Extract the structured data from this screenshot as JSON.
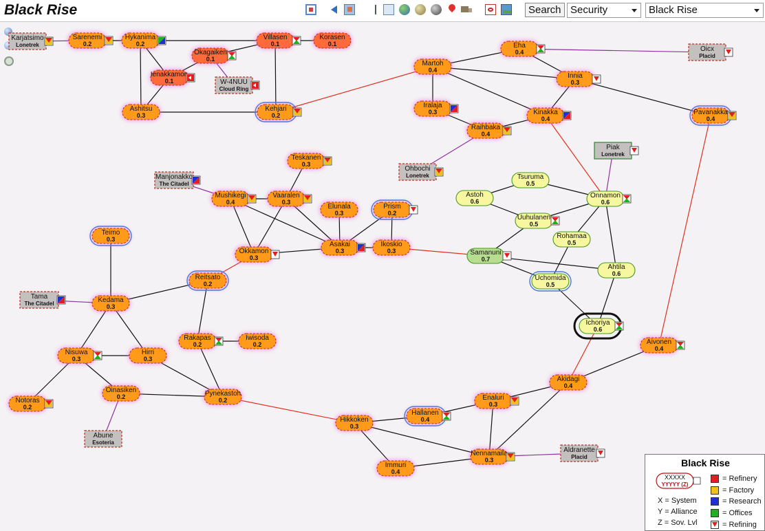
{
  "header": {
    "title": "Black Rise",
    "search_label": "Search",
    "view_mode": "Security",
    "region": "Black Rise",
    "toolbar_icons": [
      "map-icon",
      "back-icon",
      "gallery-icon",
      "table-icon",
      "globe-icon",
      "moon-icon",
      "planet-icon",
      "location-pin-icon",
      "truck-icon",
      "pdf-icon",
      "picture-icon"
    ]
  },
  "legend": {
    "title": "Black Rise",
    "sample_name": "XXXXX",
    "sample_sub": "YYYYY (Z)",
    "keys": [
      "X  = System",
      "Y  = Alliance",
      "Z  = Sov. Lvl"
    ],
    "items": [
      {
        "label": "= Refinery",
        "color": "#e02020"
      },
      {
        "label": "= Factory",
        "color": "#f0c020"
      },
      {
        "label": "= Research",
        "color": "#2030d0"
      },
      {
        "label": "= Offices",
        "color": "#20b020"
      },
      {
        "label": "= Refining",
        "color": "#e02020"
      }
    ]
  },
  "colors": {
    "low": "#ff9a1a",
    "low_dark": "#ff6a3a",
    "mid": "#f7f7a0",
    "mid_green": "#b8dc90",
    "ext": "#c4c0c0",
    "conn": "#111",
    "region_conn": "#e03020",
    "const_conn": "#9030a0"
  },
  "systems": [
    {
      "id": "karjatsimo",
      "name": "Karjatsimo",
      "sub": "Lonetrek",
      "type": "ext"
    },
    {
      "id": "sarenemi",
      "name": "Sarenemi",
      "sub": "0.2",
      "type": "low"
    },
    {
      "id": "hykanima",
      "name": "Hykanima",
      "sub": "0.2",
      "type": "low"
    },
    {
      "id": "villasen",
      "name": "Villasen",
      "sub": "0.1",
      "type": "low2"
    },
    {
      "id": "korasen",
      "name": "Korasen",
      "sub": "0.1",
      "type": "low2"
    },
    {
      "id": "okagaiken",
      "name": "Okagaiken",
      "sub": "0.1",
      "type": "low2"
    },
    {
      "id": "ienakkamon",
      "name": "Ienakkamon",
      "sub": "0.1",
      "type": "low2"
    },
    {
      "id": "w4nuu",
      "name": "W-4NUU",
      "sub": "Cloud Ring",
      "type": "ext"
    },
    {
      "id": "ashitsu",
      "name": "Ashitsu",
      "sub": "0.3",
      "type": "low"
    },
    {
      "id": "kehjari",
      "name": "Kehjari",
      "sub": "0.2",
      "type": "low",
      "ring": true
    },
    {
      "id": "eha",
      "name": "Eha",
      "sub": "0.4",
      "type": "low"
    },
    {
      "id": "oicx",
      "name": "Oicx",
      "sub": "Placid",
      "type": "ext"
    },
    {
      "id": "martoh",
      "name": "Martoh",
      "sub": "0.4",
      "type": "low"
    },
    {
      "id": "innia",
      "name": "Innia",
      "sub": "0.3",
      "type": "low"
    },
    {
      "id": "iralaja",
      "name": "Iralaja",
      "sub": "0.3",
      "type": "low"
    },
    {
      "id": "kinakka",
      "name": "Kinakka",
      "sub": "0.4",
      "type": "low"
    },
    {
      "id": "raihbaka",
      "name": "Raihbaka",
      "sub": "0.4",
      "type": "low"
    },
    {
      "id": "pavanakka",
      "name": "Pavanakka",
      "sub": "0.4",
      "type": "low",
      "ring": true
    },
    {
      "id": "piak",
      "name": "Piak",
      "sub": "Lonetrek",
      "type": "ext_green"
    },
    {
      "id": "ohbochi",
      "name": "Ohbochi",
      "sub": "Lonetrek",
      "type": "ext"
    },
    {
      "id": "teskanen",
      "name": "Teskanen",
      "sub": "0.3",
      "type": "low"
    },
    {
      "id": "manjonakko",
      "name": "Manjonakko",
      "sub": "The Citadel",
      "type": "ext"
    },
    {
      "id": "mushikegi",
      "name": "Mushikegi",
      "sub": "0.4",
      "type": "low"
    },
    {
      "id": "vaaralen",
      "name": "Vaaralen",
      "sub": "0.3",
      "type": "low"
    },
    {
      "id": "elunala",
      "name": "Elunala",
      "sub": "0.3",
      "type": "low"
    },
    {
      "id": "prism",
      "name": "Prism",
      "sub": "0.2",
      "type": "low",
      "ring": true
    },
    {
      "id": "tsuruma",
      "name": "Tsuruma",
      "sub": "0.5",
      "type": "mid"
    },
    {
      "id": "astoh",
      "name": "Astoh",
      "sub": "0.6",
      "type": "mid"
    },
    {
      "id": "onnamon",
      "name": "Onnamon",
      "sub": "0.6",
      "type": "mid"
    },
    {
      "id": "uuhulanen",
      "name": "Uuhulanen",
      "sub": "0.5",
      "type": "mid"
    },
    {
      "id": "rohamaa",
      "name": "Rohamaa",
      "sub": "0.5",
      "type": "mid"
    },
    {
      "id": "teimo",
      "name": "Teimo",
      "sub": "0.3",
      "type": "low",
      "ring": true
    },
    {
      "id": "okkamon",
      "name": "Okkamon",
      "sub": "0.3",
      "type": "low"
    },
    {
      "id": "asakai",
      "name": "Asakai",
      "sub": "0.3",
      "type": "low"
    },
    {
      "id": "ikoskio",
      "name": "Ikoskio",
      "sub": "0.3",
      "type": "low"
    },
    {
      "id": "samanuni",
      "name": "Samanuni",
      "sub": "0.7",
      "type": "mid_green"
    },
    {
      "id": "ahtila",
      "name": "Ahtila",
      "sub": "0.6",
      "type": "mid"
    },
    {
      "id": "uchomida",
      "name": "Uchomida",
      "sub": "0.5",
      "type": "mid",
      "ring": true
    },
    {
      "id": "reitsato",
      "name": "Reitsato",
      "sub": "0.2",
      "type": "low",
      "ring": true
    },
    {
      "id": "tama",
      "name": "Tama",
      "sub": "The Citadel",
      "type": "ext"
    },
    {
      "id": "kedama",
      "name": "Kedama",
      "sub": "0.3",
      "type": "low"
    },
    {
      "id": "ichoriya",
      "name": "Ichoriya",
      "sub": "0.6",
      "type": "mid",
      "current": true
    },
    {
      "id": "rakapas",
      "name": "Rakapas",
      "sub": "0.2",
      "type": "low"
    },
    {
      "id": "iwisoda",
      "name": "Iwisoda",
      "sub": "0.2",
      "type": "low"
    },
    {
      "id": "aivonen",
      "name": "Aivonen",
      "sub": "0.4",
      "type": "low"
    },
    {
      "id": "nisuwa",
      "name": "Nisuwa",
      "sub": "0.3",
      "type": "low"
    },
    {
      "id": "hirri",
      "name": "Hirri",
      "sub": "0.3",
      "type": "low"
    },
    {
      "id": "akidagi",
      "name": "Akidagi",
      "sub": "0.4",
      "type": "low"
    },
    {
      "id": "oinasiken",
      "name": "Oinasiken",
      "sub": "0.2",
      "type": "low"
    },
    {
      "id": "pynekastoh",
      "name": "Pynekastoh",
      "sub": "0.2",
      "type": "low"
    },
    {
      "id": "enaluri",
      "name": "Enaluri",
      "sub": "0.3",
      "type": "low"
    },
    {
      "id": "notoras",
      "name": "Notoras",
      "sub": "0.2",
      "type": "low"
    },
    {
      "id": "hallanen",
      "name": "Hallanen",
      "sub": "0.4",
      "type": "low",
      "ring": true
    },
    {
      "id": "hikkoken",
      "name": "Hikkoken",
      "sub": "0.3",
      "type": "low"
    },
    {
      "id": "abune",
      "name": "Abune",
      "sub": "Esoteria",
      "type": "ext"
    },
    {
      "id": "nennamaila",
      "name": "Nennamaila",
      "sub": "0.3",
      "type": "low"
    },
    {
      "id": "aldranette",
      "name": "Aldranette",
      "sub": "Placid",
      "type": "ext"
    },
    {
      "id": "immuri",
      "name": "Immuri",
      "sub": "0.4",
      "type": "low"
    }
  ],
  "connections": [
    [
      "karjatsimo",
      "sarenemi",
      "c"
    ],
    [
      "sarenemi",
      "hykanima",
      "n"
    ],
    [
      "hykanima",
      "villasen",
      "n"
    ],
    [
      "villasen",
      "korasen",
      "n"
    ],
    [
      "villasen",
      "okagaiken",
      "n"
    ],
    [
      "villasen",
      "kehjari",
      "n"
    ],
    [
      "okagaiken",
      "ienakkamon",
      "n"
    ],
    [
      "okagaiken",
      "w4nuu",
      "c"
    ],
    [
      "hykanima",
      "ienakkamon",
      "n"
    ],
    [
      "hykanima",
      "ashitsu",
      "n"
    ],
    [
      "ienakkamon",
      "ashitsu",
      "n"
    ],
    [
      "ashitsu",
      "kehjari",
      "n"
    ],
    [
      "kehjari",
      "martoh",
      "r"
    ],
    [
      "martoh",
      "eha",
      "n"
    ],
    [
      "martoh",
      "innia",
      "n"
    ],
    [
      "martoh",
      "iralaja",
      "n"
    ],
    [
      "martoh",
      "kinakka",
      "n"
    ],
    [
      "eha",
      "innia",
      "n"
    ],
    [
      "eha",
      "oicx",
      "c"
    ],
    [
      "innia",
      "kinakka",
      "n"
    ],
    [
      "innia",
      "pavanakka",
      "n"
    ],
    [
      "iralaja",
      "raihbaka",
      "n"
    ],
    [
      "kinakka",
      "raihbaka",
      "n"
    ],
    [
      "raihbaka",
      "ohbochi",
      "c"
    ],
    [
      "kinakka",
      "onnamon",
      "r"
    ],
    [
      "onnamon",
      "piak",
      "c"
    ],
    [
      "pavanakka",
      "aivonen",
      "r"
    ],
    [
      "teskanen",
      "vaaralen",
      "n"
    ],
    [
      "manjonakko",
      "mushikegi",
      "c"
    ],
    [
      "mushikegi",
      "vaaralen",
      "n"
    ],
    [
      "mushikegi",
      "okkamon",
      "n"
    ],
    [
      "mushikegi",
      "asakai",
      "n"
    ],
    [
      "vaaralen",
      "asakai",
      "n"
    ],
    [
      "vaaralen",
      "okkamon",
      "n"
    ],
    [
      "elunala",
      "asakai",
      "n"
    ],
    [
      "prism",
      "asakai",
      "n"
    ],
    [
      "prism",
      "ikoskio",
      "n"
    ],
    [
      "asakai",
      "ikoskio",
      "n"
    ],
    [
      "asakai",
      "okkamon",
      "n"
    ],
    [
      "okkamon",
      "reitsato",
      "r"
    ],
    [
      "ikoskio",
      "samanuni",
      "r"
    ],
    [
      "tsuruma",
      "astoh",
      "n"
    ],
    [
      "tsuruma",
      "onnamon",
      "n"
    ],
    [
      "astoh",
      "uuhulanen",
      "n"
    ],
    [
      "onnamon",
      "uuhulanen",
      "n"
    ],
    [
      "uuhulanen",
      "samanuni",
      "n"
    ],
    [
      "onnamon",
      "rohamaa",
      "n"
    ],
    [
      "onnamon",
      "ahtila",
      "n"
    ],
    [
      "rohamaa",
      "uchomida",
      "n"
    ],
    [
      "samanuni",
      "ahtila",
      "n"
    ],
    [
      "samanuni",
      "uchomida",
      "n"
    ],
    [
      "uchomida",
      "ichoriya",
      "n"
    ],
    [
      "ahtila",
      "ichoriya",
      "n"
    ],
    [
      "ichoriya",
      "akidagi",
      "r"
    ],
    [
      "teimo",
      "kedama",
      "n"
    ],
    [
      "tama",
      "kedama",
      "c"
    ],
    [
      "kedama",
      "reitsato",
      "n"
    ],
    [
      "kedama",
      "nisuwa",
      "n"
    ],
    [
      "kedama",
      "hirri",
      "n"
    ],
    [
      "reitsato",
      "rakapas",
      "n"
    ],
    [
      "rakapas",
      "iwisoda",
      "n"
    ],
    [
      "rakapas",
      "pynekastoh",
      "n"
    ],
    [
      "hirri",
      "pynekastoh",
      "n"
    ],
    [
      "nisuwa",
      "hirri",
      "n"
    ],
    [
      "nisuwa",
      "notoras",
      "n"
    ],
    [
      "nisuwa",
      "oinasiken",
      "n"
    ],
    [
      "oinasiken",
      "abune",
      "c"
    ],
    [
      "oinasiken",
      "pynekastoh",
      "n"
    ],
    [
      "pynekastoh",
      "hikkoken",
      "r"
    ],
    [
      "hikkoken",
      "hallanen",
      "n"
    ],
    [
      "hikkoken",
      "immuri",
      "n"
    ],
    [
      "hikkoken",
      "nennamaila",
      "n"
    ],
    [
      "hallanen",
      "enaluri",
      "n"
    ],
    [
      "enaluri",
      "akidagi",
      "n"
    ],
    [
      "enaluri",
      "nennamaila",
      "n"
    ],
    [
      "akidagi",
      "aivonen",
      "n"
    ],
    [
      "akidagi",
      "nennamaila",
      "n"
    ],
    [
      "immuri",
      "nennamaila",
      "n"
    ],
    [
      "nennamaila",
      "aldranette",
      "c"
    ]
  ]
}
